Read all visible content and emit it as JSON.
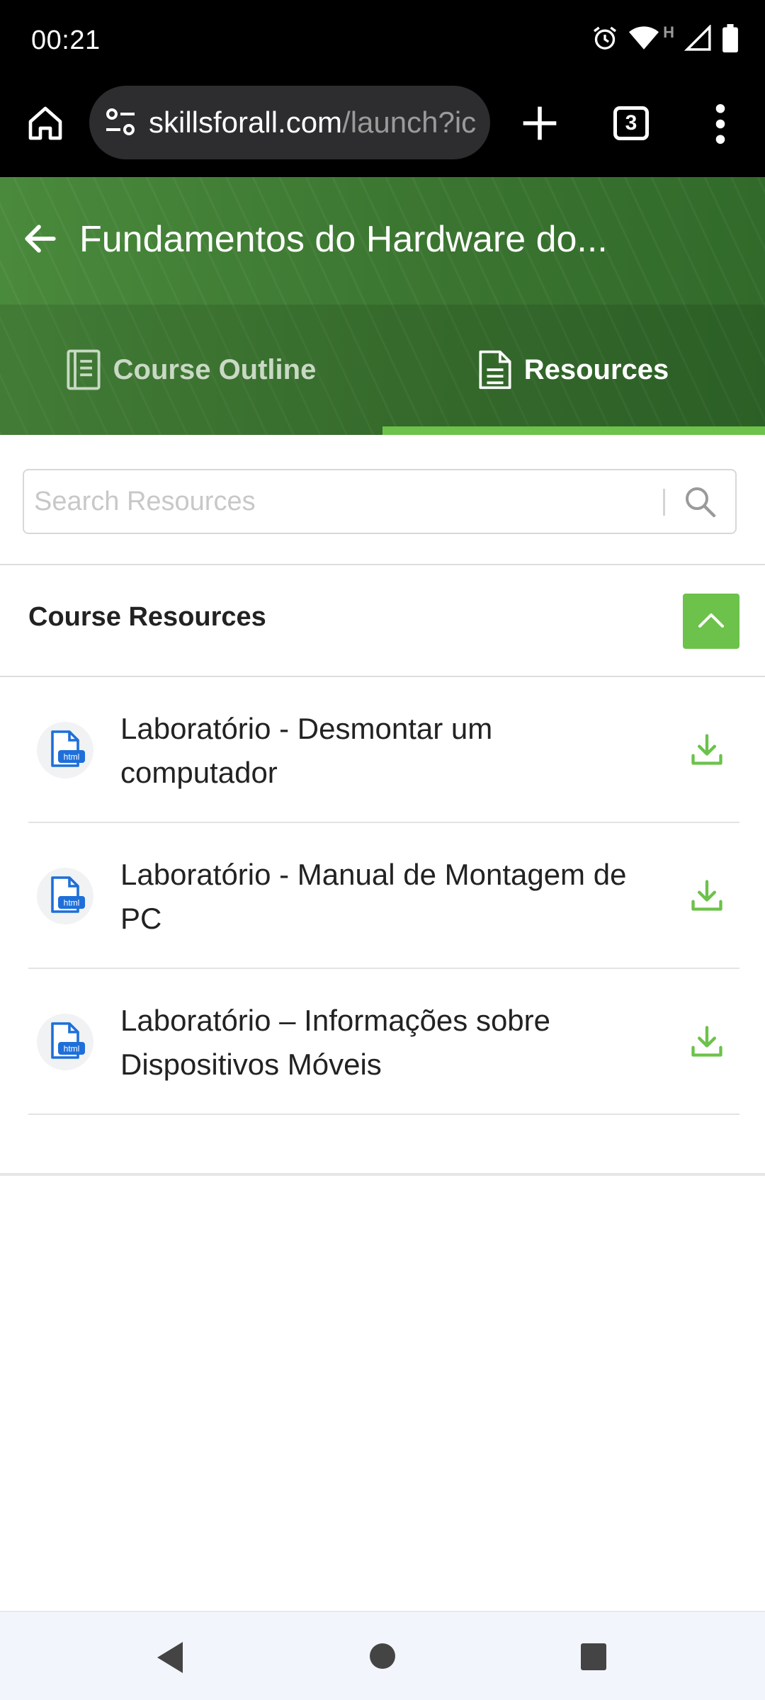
{
  "status_bar": {
    "time": "00:21",
    "network_label": "H",
    "icons": [
      "alarm-icon",
      "wifi-icon",
      "signal-icon",
      "battery-icon"
    ]
  },
  "browser": {
    "url_domain": "skillsforall.com",
    "url_path": "/launch?ic",
    "tab_count": "3",
    "icons": [
      "home-icon",
      "site-info-icon",
      "plus-icon",
      "more-vert-icon"
    ]
  },
  "course": {
    "title": "Fundamentos do Hardware do...",
    "tabs": [
      {
        "label": "Course Outline",
        "icon": "outline-icon",
        "active": false
      },
      {
        "label": "Resources",
        "icon": "document-icon",
        "active": true
      }
    ]
  },
  "search": {
    "placeholder": "Search Resources",
    "value": ""
  },
  "section": {
    "title": "Course Resources",
    "expanded": true
  },
  "resources": [
    {
      "label": "Laboratório - Desmontar um computador",
      "file_type": "html"
    },
    {
      "label": "Laboratório - Manual de Montagem de PC",
      "file_type": "html"
    },
    {
      "label": "Laboratório – Informações sobre Dispositivos Móveis",
      "file_type": "html"
    }
  ],
  "colors": {
    "accent_green": "#6cc24a",
    "header_green": "#3e7a35",
    "file_icon_blue": "#1e6fd9"
  }
}
